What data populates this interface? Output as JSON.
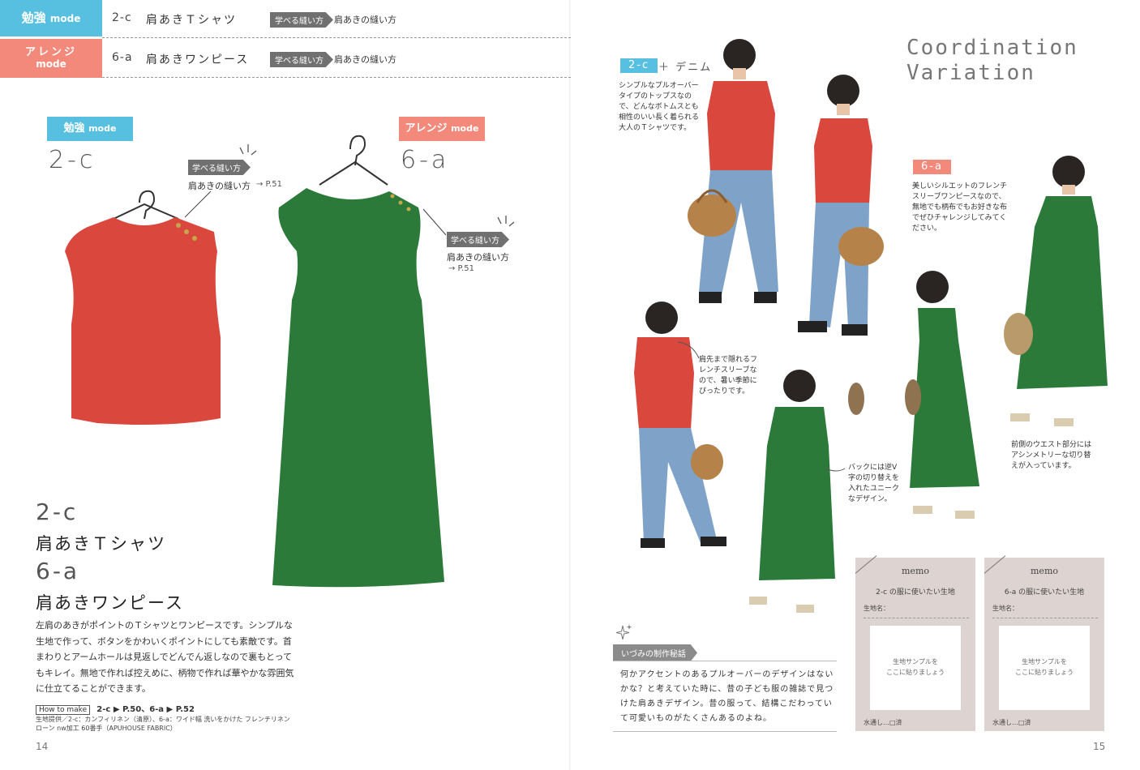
{
  "header": {
    "rows": [
      {
        "tab_main": "勉強",
        "tab_sub": "mode",
        "code": "2-c",
        "title": "肩あきＴシャツ",
        "badge": "学べる縫い方",
        "link": "肩あきの縫い方"
      },
      {
        "tab_main": "アレンジ",
        "tab_sub": "mode",
        "code": "6-a",
        "title": "肩あきワンピース",
        "badge": "学べる縫い方",
        "link": "肩あきの縫い方"
      }
    ]
  },
  "items": {
    "study": {
      "pill_main": "勉強",
      "pill_sub": "mode",
      "code": "2-c",
      "tag": "学べる縫い方",
      "text": "肩あきの縫い方",
      "ref": "→ P.51"
    },
    "arrange": {
      "pill_main": "アレンジ",
      "pill_sub": "mode",
      "code": "6-a",
      "tag": "学べる縫い方",
      "text": "肩あきの縫い方",
      "ref": "→ P.51"
    }
  },
  "description": {
    "code1": "2-c",
    "title1": "肩あきＴシャツ",
    "code2": "6-a",
    "title2": "肩あきワンピース",
    "body": "左肩のあきがポイントのＴシャツとワンピースです。シンプルな生地で作って、ボタンをかわいくポイントにしても素敵です。首まわりとアームホールは見返しでどんでん返しなので裏もとってもキレイ。無地で作れば控えめに、柄物で作れば華やかな雰囲気に仕立てることができます。",
    "howto_label": "How to make",
    "howto_text": "2-c ▶ P.50、6-a ▶ P.52",
    "fabric": "生地提供／2-c：カンフィリネン（清原）、6-a：ワイド幅 洗いをかけた フレンチリネンローン nw加工 60番手（APUHOUSE FABRIC）"
  },
  "page_left": "14",
  "page_right": "15",
  "coordination": {
    "title_line1": "Coordination",
    "title_line2": "Variation",
    "tag1": "2-c",
    "tag1_suffix": "＋ デニム",
    "caption1": "シンプルなプルオーバータイプのトップスなので、どんなボトムスとも相性のいい長く着られる大人のＴシャツです。",
    "tag2": "6-a",
    "caption2": "美しいシルエットのフレンチスリーブワンピースなので、無地でも柄布でもお好きな布でぜひチャレンジしてみてください。",
    "caption3": "肩先まで隠れるフレンチスリーブなので、暑い季節にぴったりです。",
    "caption4": "バックには逆V字の切り替えを入れたユニークなデザイン。",
    "caption5": "前側のウエスト部分にはアシンメトリーな切り替えが入っています。"
  },
  "story": {
    "tag": "いづみの制作秘話",
    "body": "何かアクセントのあるプルオーバーのデザインはないかな？と考えていた時に、昔の子ども服の雑誌で見つけた肩あきデザイン。昔の服って、結構こだわっていて可愛いものがたくさんあるのよね。"
  },
  "memos": [
    {
      "title": "memo",
      "sub": "2-c の服に使いたい生地",
      "name_label": "生地名：",
      "swatch": "生地サンプルを\nここに貼りましょう",
      "wash": "水通し…□済"
    },
    {
      "title": "memo",
      "sub": "6-a の服に使いたい生地",
      "name_label": "生地名：",
      "swatch": "生地サンプルを\nここに貼りましょう",
      "wash": "水通し…□済"
    }
  ],
  "colors": {
    "study": "#57bfe0",
    "arrange": "#f2897b",
    "red_garment": "#d9473d",
    "green_garment": "#2c7a3a",
    "denim": "#7fa3c8",
    "memo_bg": "#ddd3d0"
  }
}
